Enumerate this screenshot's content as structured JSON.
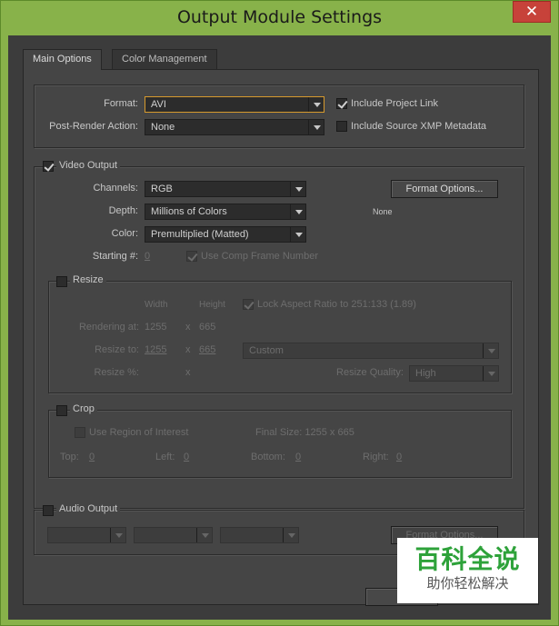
{
  "window": {
    "title": "Output Module Settings",
    "close_label": "✕"
  },
  "tabs": [
    {
      "label": "Main Options"
    },
    {
      "label": "Color Management"
    }
  ],
  "top": {
    "format_label": "Format:",
    "format_value": "AVI",
    "post_render_label": "Post-Render Action:",
    "post_render_value": "None",
    "include_project_link": "Include Project Link",
    "include_project_link_checked": true,
    "include_xmp": "Include Source XMP Metadata",
    "include_xmp_checked": false
  },
  "video": {
    "section_label": "Video Output",
    "checked": true,
    "channels_label": "Channels:",
    "channels_value": "RGB",
    "depth_label": "Depth:",
    "depth_value": "Millions of Colors",
    "color_label": "Color:",
    "color_value": "Premultiplied (Matted)",
    "starting_label": "Starting #:",
    "starting_value": "0",
    "use_comp_frame": "Use Comp Frame Number",
    "format_options_button": "Format Options...",
    "codec_text": "None"
  },
  "resize": {
    "section_label": "Resize",
    "width_header": "Width",
    "height_header": "Height",
    "lock_aspect": "Lock Aspect Ratio to 251:133 (1.89)",
    "rendering_at_label": "Rendering at:",
    "render_w": "1255",
    "render_x": "x",
    "render_h": "665",
    "resize_to_label": "Resize to:",
    "resize_w": "1255",
    "resize_x": "x",
    "resize_h": "665",
    "preset_value": "Custom",
    "resize_pct_label": "Resize %:",
    "pct_x": "x",
    "quality_label": "Resize Quality:",
    "quality_value": "High"
  },
  "crop": {
    "section_label": "Crop",
    "use_roi": "Use Region of Interest",
    "final_size": "Final Size: 1255 x 665",
    "top_label": "Top:",
    "top_value": "0",
    "left_label": "Left:",
    "left_value": "0",
    "bottom_label": "Bottom:",
    "bottom_value": "0",
    "right_label": "Right:",
    "right_value": "0"
  },
  "audio": {
    "section_label": "Audio Output",
    "format_options_button": "Format Options..."
  },
  "watermark": {
    "title": "百科全说",
    "subtitle": "助你轻松解决"
  },
  "colors": {
    "accent_focus": "#d69a2e",
    "panel": "#454545",
    "close": "#c7423a"
  }
}
